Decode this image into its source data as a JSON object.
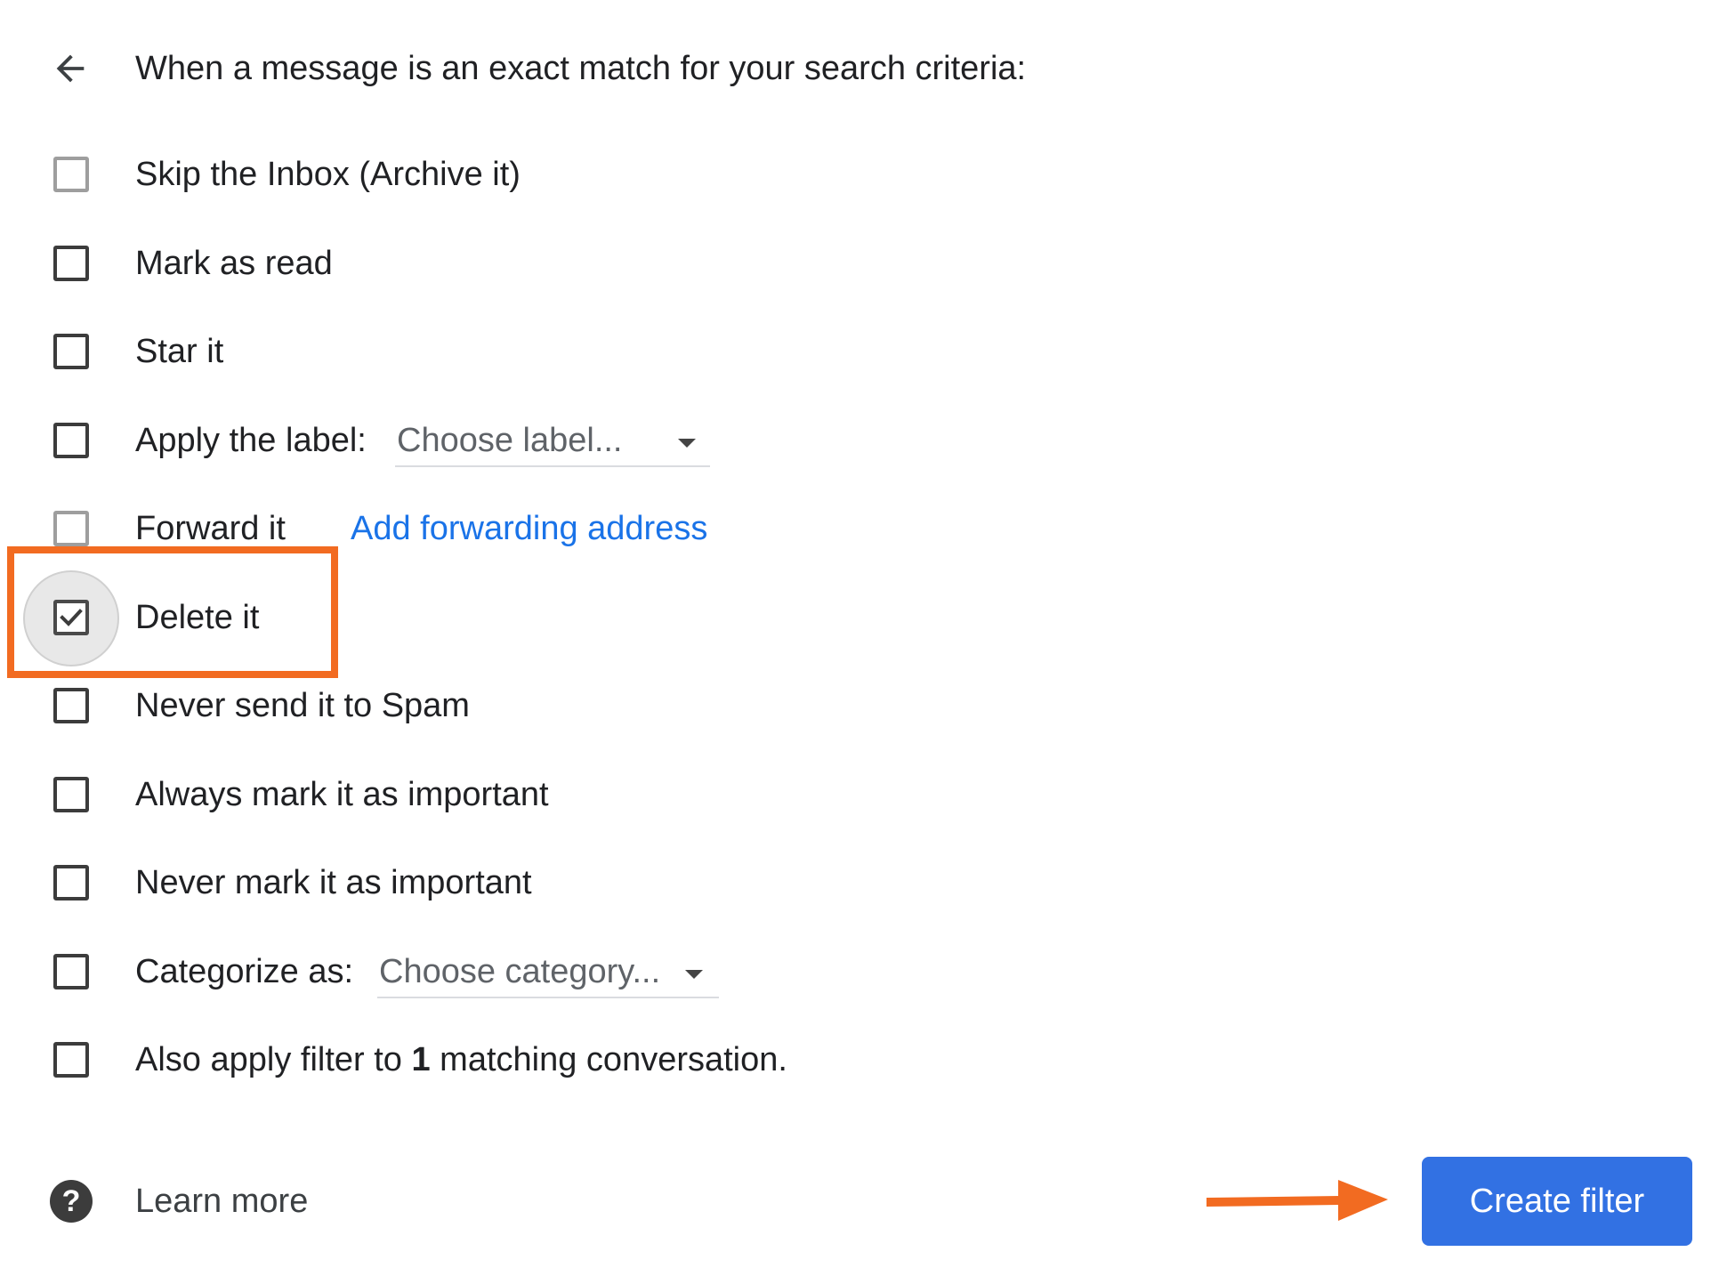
{
  "header": {
    "title": "When a message is an exact match for your search criteria:",
    "back_icon": "arrow-left-icon"
  },
  "options": [
    {
      "label": "Skip the Inbox (Archive it)",
      "checked": false
    },
    {
      "label": "Mark as read",
      "checked": false
    },
    {
      "label": "Star it",
      "checked": false
    },
    {
      "label": "Apply the label:",
      "checked": false,
      "dropdown_value": "Choose label..."
    },
    {
      "label": "Forward it",
      "checked": false,
      "link_text": "Add forwarding address"
    },
    {
      "label": "Delete it",
      "checked": true
    },
    {
      "label": "Never send it to Spam",
      "checked": false
    },
    {
      "label": "Always mark it as important",
      "checked": false
    },
    {
      "label": "Never mark it as important",
      "checked": false
    },
    {
      "label": "Categorize as:",
      "checked": false,
      "dropdown_value": "Choose category..."
    },
    {
      "label_prefix": "Also apply filter to ",
      "label_count": "1",
      "label_suffix": " matching conversation.",
      "checked": false
    }
  ],
  "footer": {
    "help_icon": "help-circle-icon",
    "help_glyph": "?",
    "learn_more": "Learn more",
    "create_button": "Create filter"
  },
  "colors": {
    "accent_blue": "#1a73e8",
    "button_blue": "#3271e3",
    "highlight_orange": "#f26b21"
  }
}
